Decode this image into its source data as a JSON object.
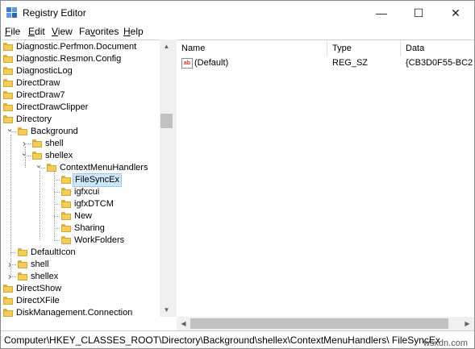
{
  "window": {
    "title": "Registry Editor",
    "controls": {
      "minimize": "—",
      "maximize": "☐",
      "close": "✕"
    }
  },
  "menu": [
    {
      "label": "File",
      "hotkey_index": 0
    },
    {
      "label": "Edit",
      "hotkey_index": 0
    },
    {
      "label": "View",
      "hotkey_index": 0
    },
    {
      "label": "Favorites",
      "hotkey_index": 2
    },
    {
      "label": "Help",
      "hotkey_index": 0
    }
  ],
  "tree": [
    {
      "label": "Diagnostic.Perfmon.Document",
      "depth": 0
    },
    {
      "label": "Diagnostic.Resmon.Config",
      "depth": 0
    },
    {
      "label": "DiagnosticLog",
      "depth": 0
    },
    {
      "label": "DirectDraw",
      "depth": 0
    },
    {
      "label": "DirectDraw7",
      "depth": 0
    },
    {
      "label": "DirectDrawClipper",
      "depth": 0
    },
    {
      "label": "Directory",
      "depth": 0
    },
    {
      "label": "Background",
      "depth": 1,
      "chevron": "expanded"
    },
    {
      "label": "shell",
      "depth": 2,
      "chevron": "collapsed"
    },
    {
      "label": "shellex",
      "depth": 2,
      "chevron": "expanded"
    },
    {
      "label": "ContextMenuHandlers",
      "depth": 3,
      "chevron": "expanded"
    },
    {
      "label": "FileSyncEx",
      "depth": 4,
      "selected": true
    },
    {
      "label": "igfxcui",
      "depth": 4
    },
    {
      "label": "igfxDTCM",
      "depth": 4
    },
    {
      "label": "New",
      "depth": 4
    },
    {
      "label": "Sharing",
      "depth": 4
    },
    {
      "label": "WorkFolders",
      "depth": 4
    },
    {
      "label": "DefaultIcon",
      "depth": 1
    },
    {
      "label": "shell",
      "depth": 1,
      "chevron": "collapsed"
    },
    {
      "label": "shellex",
      "depth": 1,
      "chevron": "collapsed"
    },
    {
      "label": "DirectShow",
      "depth": 0
    },
    {
      "label": "DirectXFile",
      "depth": 0
    },
    {
      "label": "DiskManagement.Connection",
      "depth": 0
    }
  ],
  "list": {
    "columns": [
      "Name",
      "Type",
      "Data"
    ],
    "rows": [
      {
        "name": "(Default)",
        "type": "REG_SZ",
        "data": "{CB3D0F55-BC2"
      }
    ]
  },
  "statusbar": {
    "path": "Computer\\HKEY_CLASSES_ROOT\\Directory\\Background\\shellex\\ContextMenuHandlers\\ FileSyncEx"
  },
  "watermark": "wsxdn.com"
}
